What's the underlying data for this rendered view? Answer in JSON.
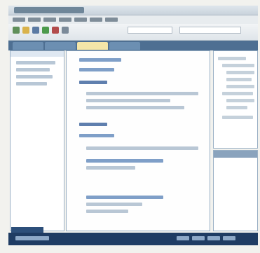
{
  "window": {
    "title": ""
  },
  "menu": {
    "items": [
      "",
      "",
      "",
      "",
      "",
      "",
      ""
    ]
  },
  "toolbar": {
    "buttons": [
      "",
      "",
      "",
      "",
      "",
      "",
      "",
      "",
      "",
      ""
    ]
  },
  "tabs": [
    "",
    "",
    "",
    ""
  ],
  "status": {
    "text": ""
  },
  "colors": {
    "accent": "#4e6f92",
    "status_bar": "#1f3c63",
    "active_tab": "#f4e6a8"
  },
  "icons": [
    "save-icon",
    "open-icon",
    "build-icon",
    "run-icon",
    "stop-icon",
    "search-icon"
  ]
}
